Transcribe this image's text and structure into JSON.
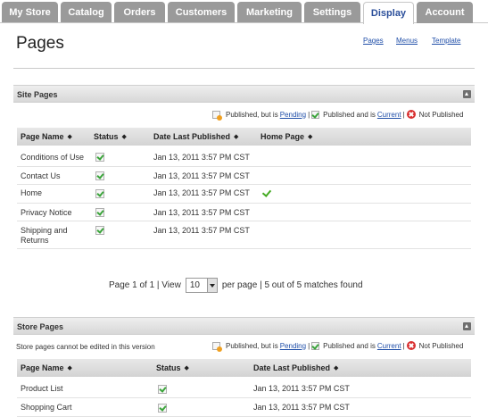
{
  "tabs": [
    {
      "label": "My Store",
      "active": false
    },
    {
      "label": "Catalog",
      "active": false
    },
    {
      "label": "Orders",
      "active": false
    },
    {
      "label": "Customers",
      "active": false
    },
    {
      "label": "Marketing",
      "active": false
    },
    {
      "label": "Settings",
      "active": false
    },
    {
      "label": "Display",
      "active": true
    },
    {
      "label": "Account",
      "active": false
    }
  ],
  "page_title": "Pages",
  "top_links": [
    "Pages",
    "Menus",
    "Template"
  ],
  "legend": {
    "pending_prefix": "Published, but is",
    "pending_link": "Pending",
    "current_prefix": "Published and is",
    "current_link": "Current",
    "separator": "|",
    "not_published": "Not Published"
  },
  "site_pages": {
    "title": "Site Pages",
    "columns": [
      "Page Name",
      "Status",
      "Date Last Published",
      "Home Page"
    ],
    "rows": [
      {
        "name": "Conditions of Use",
        "status": "current",
        "date": "Jan 13, 2011 3:57 PM CST",
        "home": false
      },
      {
        "name": "Contact Us",
        "status": "current",
        "date": "Jan 13, 2011 3:57 PM CST",
        "home": false
      },
      {
        "name": "Home",
        "status": "current",
        "date": "Jan 13, 2011 3:57 PM CST",
        "home": true
      },
      {
        "name": "Privacy Notice",
        "status": "current",
        "date": "Jan 13, 2011 3:57 PM CST",
        "home": false
      },
      {
        "name": "Shipping and",
        "name2": "Returns",
        "status": "current",
        "date": "Jan 13, 2011 3:57 PM CST",
        "home": false
      }
    ]
  },
  "pager": {
    "page_text": "Page 1 of 1 | View",
    "per_page_value": "10",
    "suffix": "per page | 5 out of 5 matches found"
  },
  "store_pages": {
    "title": "Store Pages",
    "note": "Store pages cannot be edited in this version",
    "columns": [
      "Page Name",
      "Status",
      "Date Last Published"
    ],
    "rows": [
      {
        "name": "Product List",
        "status": "current",
        "date": "Jan 13, 2011 3:57 PM CST"
      },
      {
        "name": "Shopping Cart",
        "status": "current",
        "date": "Jan 13, 2011 3:57 PM CST"
      }
    ]
  }
}
